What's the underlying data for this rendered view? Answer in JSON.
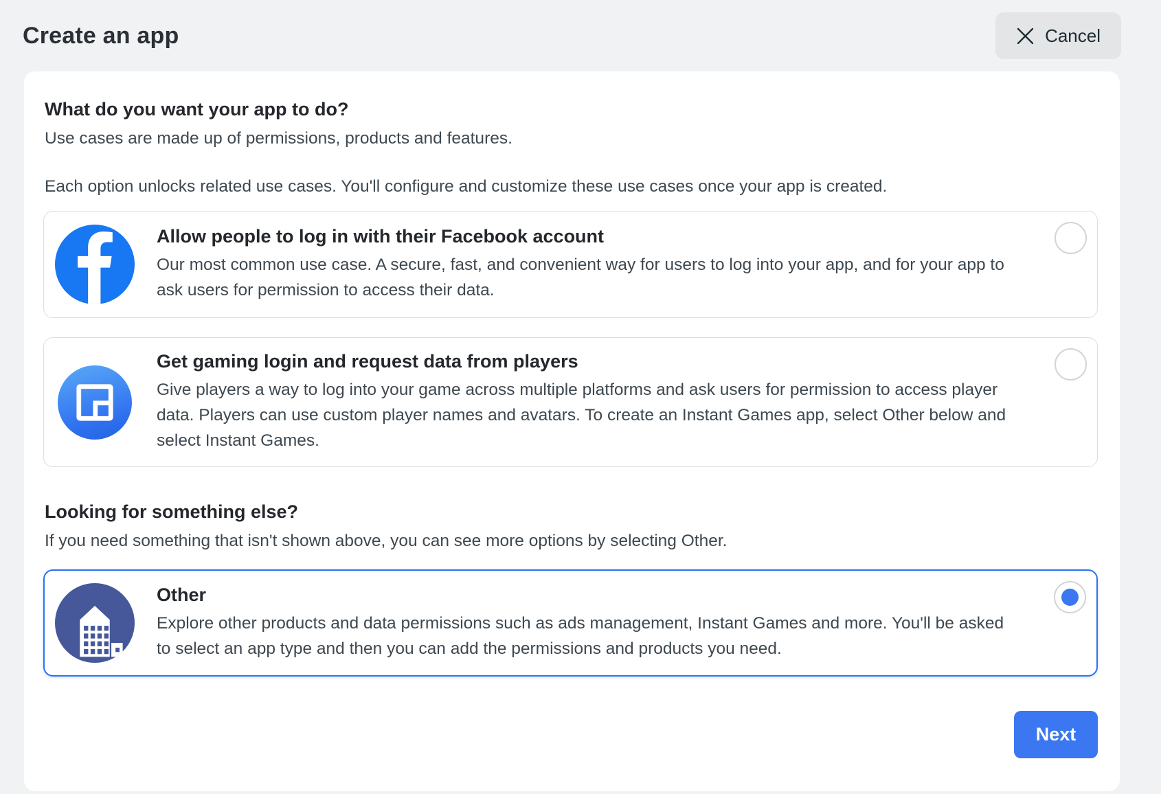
{
  "header": {
    "title": "Create an app",
    "cancel_label": "Cancel"
  },
  "intro": {
    "heading": "What do you want your app to do?",
    "subheading": "Use cases are made up of permissions, products and features.",
    "description": "Each option unlocks related use cases. You'll configure and customize these use cases once your app is created."
  },
  "options": [
    {
      "id": "facebook-login",
      "icon": "facebook-logo-icon",
      "title": "Allow people to log in with their Facebook account",
      "description": "Our most common use case. A secure, fast, and convenient way for users to log into your app, and for your app to ask users for permission to access their data.",
      "selected": false
    },
    {
      "id": "gaming-login",
      "icon": "facebook-gaming-icon",
      "title": "Get gaming login and request data from players",
      "description": "Give players a way to log into your game across multiple platforms and ask users for permission to access player data. Players can use custom player names and avatars. To create an Instant Games app, select Other below and select Instant Games.",
      "selected": false
    },
    {
      "id": "other",
      "icon": "building-icon",
      "title": "Other",
      "description": "Explore other products and data permissions such as ads management, Instant Games and more. You'll be asked to select an app type and then you can add the permissions and products you need.",
      "selected": true
    }
  ],
  "something_else": {
    "heading": "Looking for something else?",
    "description": "If you need something that isn't shown above, you can see more options by selecting Other."
  },
  "footer": {
    "next_label": "Next"
  },
  "colors": {
    "bg_gray": "#f1f2f4",
    "cancel_gray": "#e4e5e7",
    "accent_blue": "#3a77f0",
    "fb_blue": "#1877f2",
    "navy": "#46589a",
    "card_border": "#dcdee3",
    "body_text": "#3e4850"
  }
}
